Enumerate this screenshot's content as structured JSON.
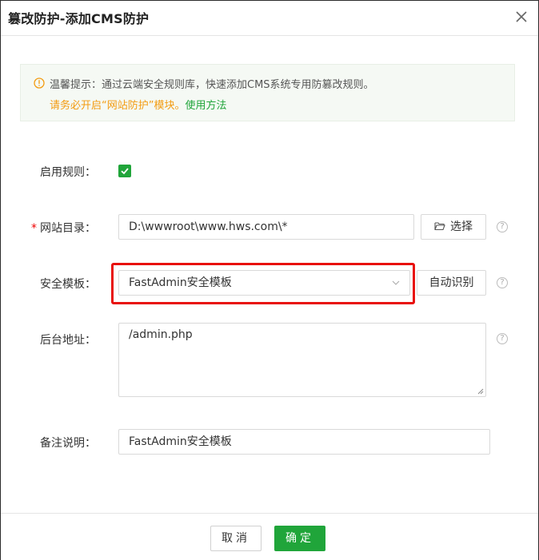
{
  "dialog": {
    "title": "篡改防护-添加CMS防护",
    "close_icon": "close-icon"
  },
  "tip": {
    "line1": "温馨提示：通过云端安全规则库，快速添加CMS系统专用防篡改规则。",
    "line2_warn": "请务必开启“网站防护”模块。",
    "line2_link": "使用方法",
    "icon": "info-circle-icon",
    "warn_color": "#f39c12",
    "link_color": "#20a53a"
  },
  "form": {
    "enable_label": "启用规则：",
    "enable_checked": true,
    "site_dir_label": "网站目录：",
    "site_dir_required": "*",
    "site_dir_value": "D:\\wwwroot\\www.hws.com\\*",
    "select_button": "选择",
    "template_label": "安全模板：",
    "template_value": "FastAdmin安全模板",
    "auto_detect_button": "自动识别",
    "backend_label": "后台地址：",
    "backend_value": "/admin.php",
    "remark_label": "备注说明：",
    "remark_value": "FastAdmin安全模板",
    "help_glyph": "?"
  },
  "footer": {
    "cancel": "取消",
    "confirm": "确定"
  },
  "colors": {
    "accent": "#20a53a",
    "highlight": "#e8100d"
  }
}
